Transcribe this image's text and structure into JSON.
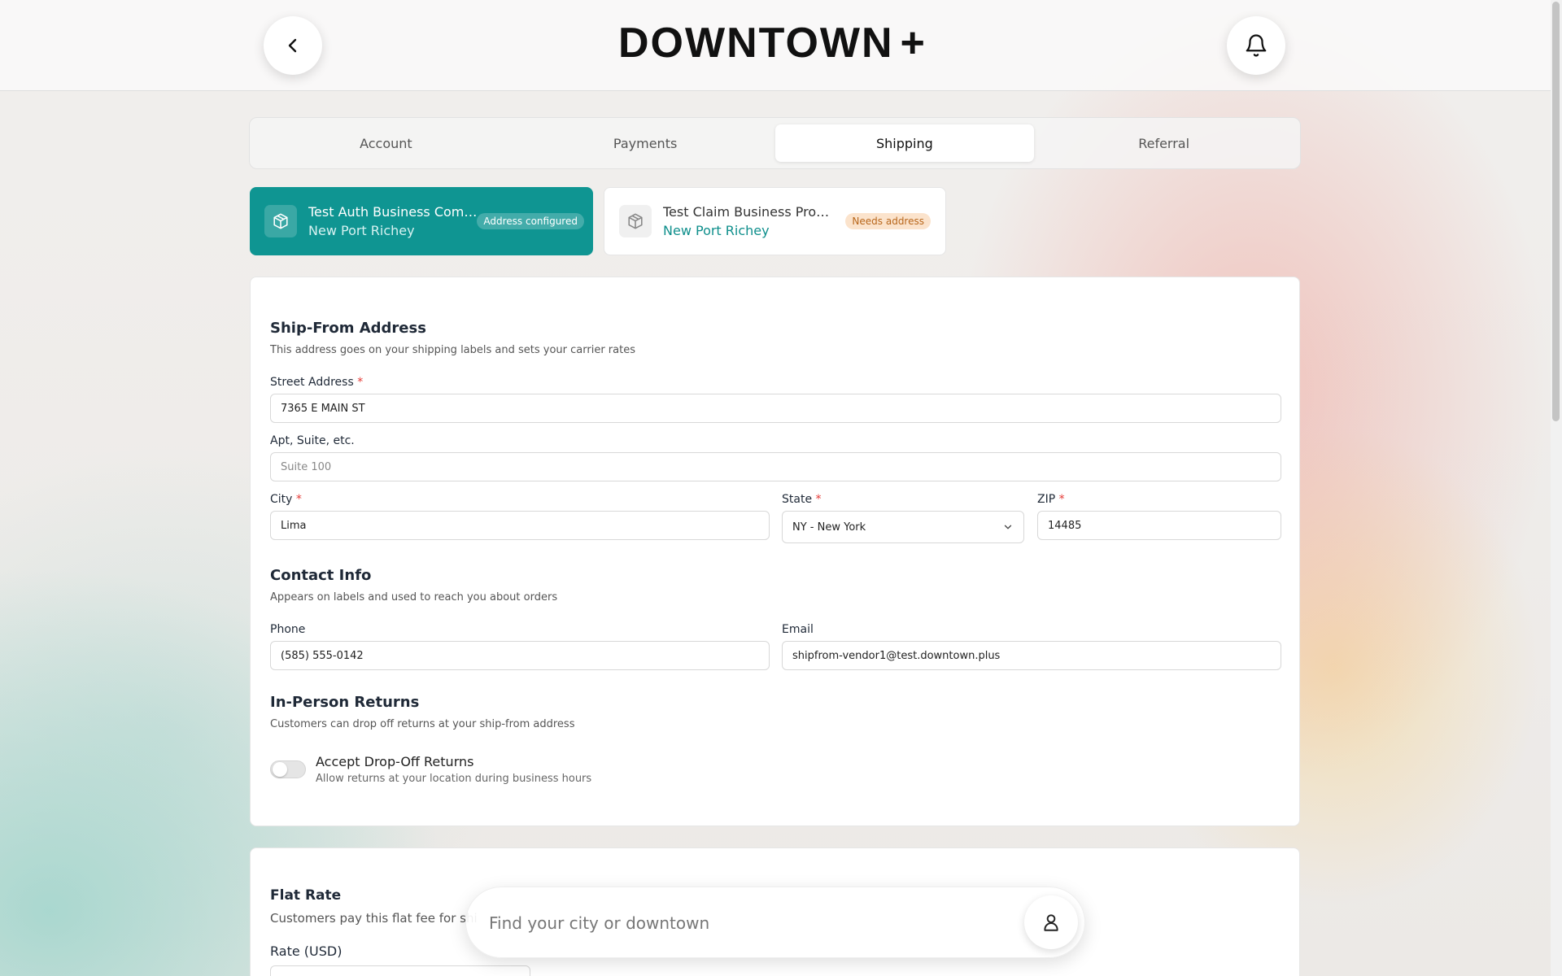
{
  "brand": {
    "logo_text": "DOWNTOWN",
    "logo_plus": "+"
  },
  "header": {
    "back_icon": "chevron-left-icon",
    "notification_icon": "bell-icon"
  },
  "tabs": [
    {
      "label": "Account",
      "active": false
    },
    {
      "label": "Payments",
      "active": false
    },
    {
      "label": "Shipping",
      "active": true
    },
    {
      "label": "Referral",
      "active": false
    }
  ],
  "profiles": [
    {
      "name": "Test Auth Business Com…",
      "city": "New Port Richey",
      "badge": "Address configured",
      "selected": true,
      "icon": "package-icon"
    },
    {
      "name": "Test Claim Business Profile",
      "city": "New Port Richey",
      "badge": "Needs address",
      "selected": false,
      "icon": "package-icon"
    }
  ],
  "ship_from": {
    "title": "Ship-From Address",
    "description": "This address goes on your shipping labels and sets your carrier rates",
    "street_label": "Street Address",
    "street_value": "7365 E MAIN ST",
    "apt_label": "Apt, Suite, etc.",
    "apt_placeholder": "Suite 100",
    "city_label": "City",
    "city_value": "Lima",
    "state_label": "State",
    "state_value": "NY - New York",
    "zip_label": "ZIP",
    "zip_value": "14485",
    "required_mark": "*"
  },
  "contact": {
    "title": "Contact Info",
    "description": "Appears on labels and used to reach you about orders",
    "phone_label": "Phone",
    "phone_value": "(585) 555-0142",
    "email_label": "Email",
    "email_value": "shipfrom-vendor1@test.downtown.plus"
  },
  "returns": {
    "title": "In-Person Returns",
    "description": "Customers can drop off returns at your ship-from address",
    "toggle_label": "Accept Drop-Off Returns",
    "toggle_desc": "Allow returns at your location during business hours",
    "toggle_on": false
  },
  "flat_rate": {
    "title": "Flat Rate",
    "description": "Customers pay this flat fee for shi",
    "rate_label": "Rate (USD)"
  },
  "search": {
    "placeholder": "Find your city or downtown",
    "profile_icon": "user-icon"
  },
  "colors": {
    "accent": "#0f9592",
    "badge_warn_bg": "#fbe3cc",
    "badge_warn_text": "#b8671c",
    "required": "#e53935"
  }
}
